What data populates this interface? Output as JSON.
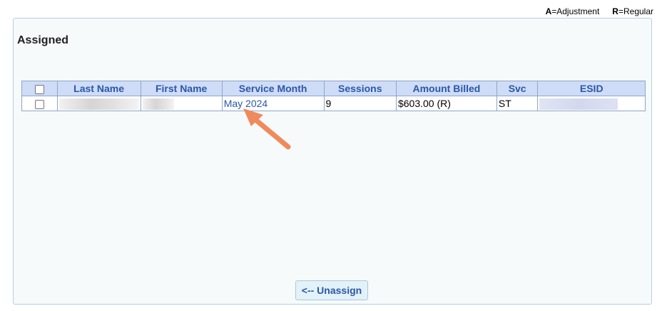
{
  "legend": {
    "adjustment_code": "A",
    "adjustment_text": "=Adjustment",
    "regular_code": "R",
    "regular_text": "=Regular"
  },
  "section": {
    "title": "Assigned"
  },
  "table": {
    "headers": [
      "",
      "Last Name",
      "First Name",
      "Service Month",
      "Sessions",
      "Amount Billed",
      "Svc",
      "ESID"
    ],
    "rows": [
      {
        "last_name": "",
        "first_name": "",
        "service_month": "May 2024",
        "sessions": "9",
        "amount_billed": "$603.00 (R)",
        "svc": "ST",
        "esid": ""
      }
    ]
  },
  "buttons": {
    "unassign": "<-- Unassign"
  },
  "colors": {
    "header_bg": "#cfdcf8",
    "header_text": "#2a58a6",
    "annotation_arrow": "#f08a5d"
  }
}
